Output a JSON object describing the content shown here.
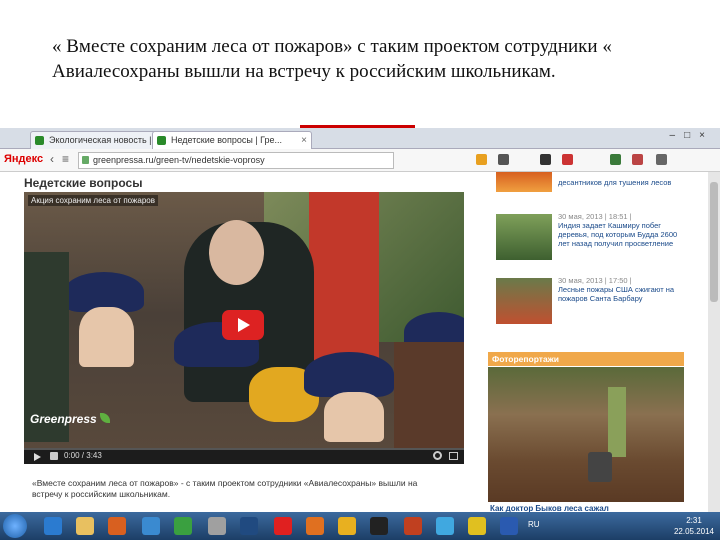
{
  "slide": {
    "title": "« Вместе сохраним леса от пожаров» с таким проектом сотрудники « Авиалесохраны вышли на встречу  к российским школьникам."
  },
  "browser": {
    "tabs": [
      {
        "label": "Экологическая новость | Гр..."
      },
      {
        "label": "Недетские вопросы | Гре..."
      }
    ],
    "brand": "Яндекс",
    "url": "greenpressa.ru/green-tv/nedetskie-voprosy",
    "toolbar_icons": [
      "star-icon",
      "download-icon",
      "bookmark-icon",
      "media-icon",
      "volume-icon",
      "settings-icon",
      "menu-icon"
    ]
  },
  "page": {
    "section_title": "Недетские вопросы",
    "video": {
      "title": "Акция сохраним леса от пожаров",
      "logo_text": "Greenpress",
      "time": "0:00 / 3:43"
    },
    "caption": "«Вместе сохраним леса от пожаров» - с таким проектом сотрудники «Авиалесохраны» вышли на встречу к российским школьникам.",
    "news": [
      {
        "date": "",
        "text": "десантников для тушения лесов"
      },
      {
        "date": "30 мая, 2013 | 18:51 |",
        "text": "Индия задает Кашмиру побег деревья, под которым Будда 2600 лет назад получил просветление"
      },
      {
        "date": "30 мая, 2013 | 17:50 |",
        "text": "Лесные пожары США сжигают на пожаров Санта Барбару"
      }
    ],
    "photo_header": "Фоторепортажи",
    "photo_caption": "Как доктор Быков леса сажал"
  },
  "taskbar": {
    "apps": [
      "ie-icon",
      "explorer-icon",
      "media-player-icon",
      "fox-icon",
      "chrome-icon",
      "winamp-icon",
      "opera-icon",
      "firefox-icon",
      "spy-icon",
      "paint-icon",
      "skype-icon",
      "chrome2-icon",
      "word-icon"
    ],
    "tray_text": "RU",
    "time": "2:31",
    "date": "22.05.2014"
  },
  "colors": {
    "video_play": "#dd2222",
    "photo_header": "#f0a84a",
    "link": "#1a4a8a",
    "taskbar": "#1c3e66"
  }
}
